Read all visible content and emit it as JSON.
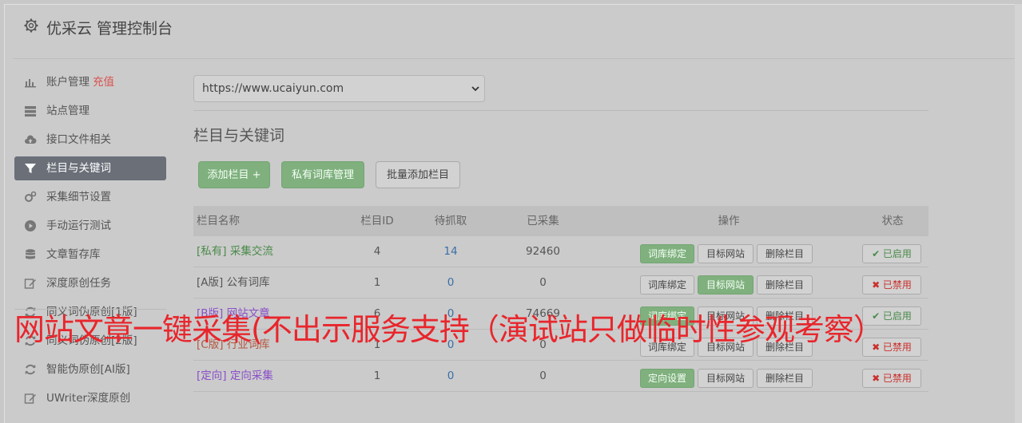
{
  "app": {
    "title": "优采云 管理控制台"
  },
  "sidebar": {
    "items": [
      {
        "label": "账户管理",
        "extra": "充值",
        "icon": "bar-chart-icon"
      },
      {
        "label": "站点管理",
        "icon": "server-icon"
      },
      {
        "label": "接口文件相关",
        "icon": "cloud-upload-icon"
      },
      {
        "label": "栏目与关键词",
        "icon": "filter-icon",
        "active": true
      },
      {
        "label": "采集细节设置",
        "icon": "cogs-icon"
      },
      {
        "label": "手动运行测试",
        "icon": "play-circle-icon"
      },
      {
        "label": "文章暂存库",
        "icon": "database-icon"
      },
      {
        "label": "深度原创任务",
        "icon": "edit-icon"
      },
      {
        "label": "同义词伪原创[1版]",
        "icon": "refresh-icon"
      },
      {
        "label": "同义词伪原创[2版]",
        "icon": "refresh-icon"
      },
      {
        "label": "智能伪原创[AI版]",
        "icon": "refresh-icon"
      },
      {
        "label": "UWriter深度原创",
        "icon": "edit-icon"
      }
    ]
  },
  "main": {
    "site_select": {
      "value": "https://www.ucaiyun.com"
    },
    "heading": "栏目与关键词",
    "buttons": {
      "add_column": "添加栏目 +",
      "private_lib": "私有词库管理",
      "batch_add": "批量添加栏目"
    },
    "table": {
      "headers": [
        "栏目名称",
        "栏目ID",
        "待抓取",
        "已采集",
        "操作",
        "状态"
      ],
      "rows": [
        {
          "tag": "[私有]",
          "name": "采集交流",
          "id": "4",
          "pending": "14",
          "collected": "92460",
          "op1": "词库绑定",
          "op2": "目标网站",
          "op3": "删除栏目",
          "status": "✔ 已启用"
        },
        {
          "tag": "[A版]",
          "name": "公有词库",
          "id": "1",
          "pending": "0",
          "collected": "0",
          "op1": "词库绑定",
          "op2": "目标网站",
          "op3": "删除栏目",
          "status": "✖ 已禁用"
        },
        {
          "tag": "[B版]",
          "name": "网站文章",
          "id": "6",
          "pending": "0",
          "collected": "74669",
          "op1": "词库绑定",
          "op2": "目标网站",
          "op3": "删除栏目",
          "status": "✔ 已启用"
        },
        {
          "tag": "[C版]",
          "name": "行业词库",
          "id": "1",
          "pending": "0",
          "collected": "0",
          "op1": "词库绑定",
          "op2": "目标网站",
          "op3": "删除栏目",
          "status": "✖ 已禁用"
        },
        {
          "tag": "[定向]",
          "name": "定向采集",
          "id": "1",
          "pending": "0",
          "collected": "0",
          "op1": "定向设置",
          "op2": "目标网站",
          "op3": "删除栏目",
          "status": "✖ 已禁用"
        }
      ]
    }
  },
  "overlay": {
    "text": "网站文章一键采集(不出示服务支持（演试站只做临时性参观考察）"
  },
  "colors": {
    "active_nav": "#6a6f78",
    "green_button": "#7fb07e",
    "overlay_red": "#e8262c"
  }
}
